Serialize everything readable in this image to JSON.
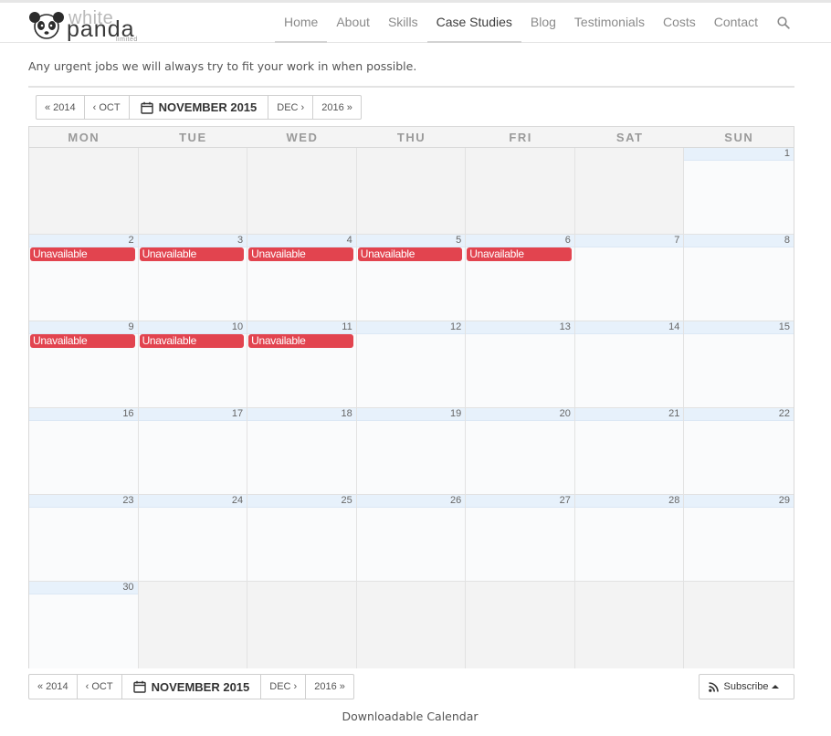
{
  "logo": {
    "word1": "white",
    "word2": "panda",
    "word3": "limited"
  },
  "nav": {
    "items": [
      {
        "label": "Home"
      },
      {
        "label": "About"
      },
      {
        "label": "Skills"
      },
      {
        "label": "Case Studies"
      },
      {
        "label": "Blog"
      },
      {
        "label": "Testimonials"
      },
      {
        "label": "Costs"
      },
      {
        "label": "Contact"
      }
    ],
    "active": "Case Studies",
    "search_icon": "search-icon"
  },
  "intro_text": "Any urgent jobs we will always try to fit your work in when possible.",
  "calendar_nav": {
    "prev_year": "« 2014",
    "prev_month": "‹ OCT",
    "current": "NOVEMBER 2015",
    "next_month": "DEC ›",
    "next_year": "2016 »",
    "calendar_icon": "calendar-icon"
  },
  "calendar": {
    "weekdays": [
      "MON",
      "TUE",
      "WED",
      "THU",
      "FRI",
      "SAT",
      "SUN"
    ],
    "first_weekday_index": 6,
    "days_in_month": 30,
    "event_label": "Unavailable",
    "events": [
      2,
      3,
      4,
      5,
      6,
      9,
      10,
      11
    ],
    "event_color": "#e2444f",
    "day_header_color": "#e7f1fb"
  },
  "subscribe": {
    "label": "Subscribe",
    "icon": "rss-icon"
  },
  "download_label": "Downloadable Calendar"
}
